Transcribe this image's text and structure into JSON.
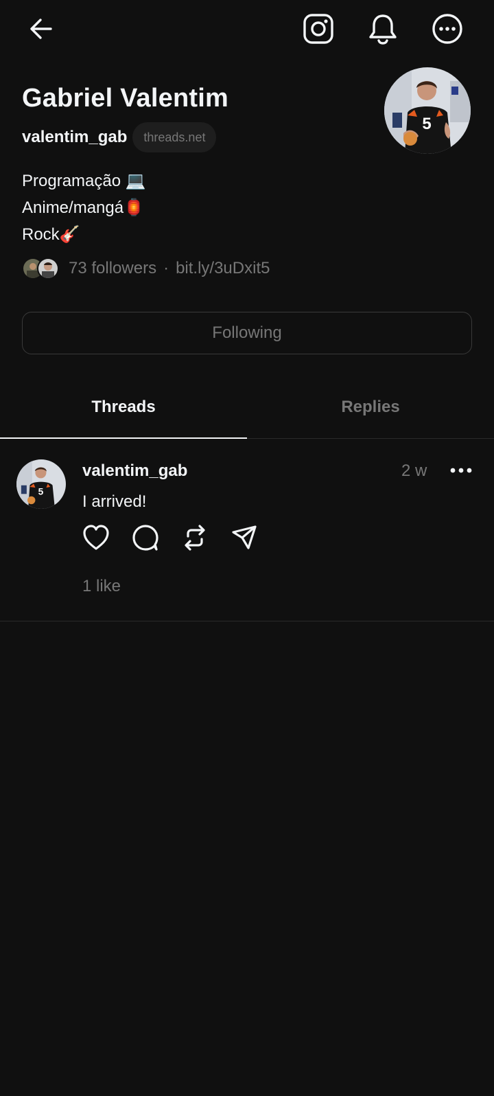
{
  "profile": {
    "name": "Gabriel Valentim",
    "handle": "valentim_gab",
    "domain": "threads.net",
    "bio": [
      "Programação 💻",
      "Anime/mangá🏮",
      "Rock🎸"
    ],
    "followers": "73 followers",
    "link": "bit.ly/3uDxit5",
    "follow_button": "Following"
  },
  "tabs": [
    {
      "label": "Threads",
      "active": true
    },
    {
      "label": "Replies",
      "active": false
    }
  ],
  "posts": [
    {
      "user": "valentim_gab",
      "time": "2 w",
      "text": "I arrived!",
      "likes": "1 like"
    }
  ],
  "icons": {
    "back": "arrow-left-icon",
    "instagram": "instagram-icon",
    "notifications": "bell-icon",
    "more": "more-circle-icon"
  },
  "colors": {
    "background": "#101010",
    "text": "#f3f5f7",
    "muted": "#777777",
    "border": "#3a3a3a"
  }
}
